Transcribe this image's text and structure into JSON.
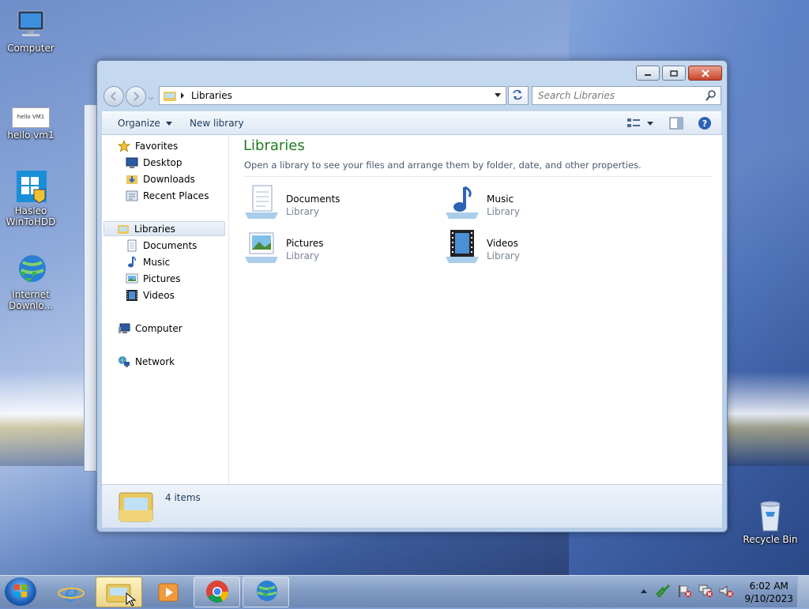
{
  "desktop": {
    "icons": [
      {
        "label": "Computer"
      },
      {
        "label": "hello vm1",
        "thumb_text": "hello VM1"
      },
      {
        "label": "Hasleo WinToHDD"
      },
      {
        "label": "Internet Downlo..."
      },
      {
        "label": "Recycle Bin"
      }
    ]
  },
  "window": {
    "address": {
      "crumb": "Libraries"
    },
    "search": {
      "placeholder": "Search Libraries"
    },
    "toolbar": {
      "organize": "Organize",
      "new_library": "New library"
    },
    "nav": {
      "favorites": "Favorites",
      "desktop": "Desktop",
      "downloads": "Downloads",
      "recent": "Recent Places",
      "libraries": "Libraries",
      "documents": "Documents",
      "music": "Music",
      "pictures": "Pictures",
      "videos": "Videos",
      "computer": "Computer",
      "network": "Network"
    },
    "main": {
      "title": "Libraries",
      "subtitle": "Open a library to see your files and arrange them by folder, date, and other properties.",
      "libraries": [
        {
          "name": "Documents",
          "type": "Library"
        },
        {
          "name": "Music",
          "type": "Library"
        },
        {
          "name": "Pictures",
          "type": "Library"
        },
        {
          "name": "Videos",
          "type": "Library"
        }
      ]
    },
    "status": {
      "count": "4 items"
    }
  },
  "taskbar": {
    "clock": {
      "time": "6:02 AM",
      "date": "9/10/2023"
    }
  },
  "colors": {
    "title_green": "#1e7b1e",
    "selection": "#dce6f3"
  }
}
